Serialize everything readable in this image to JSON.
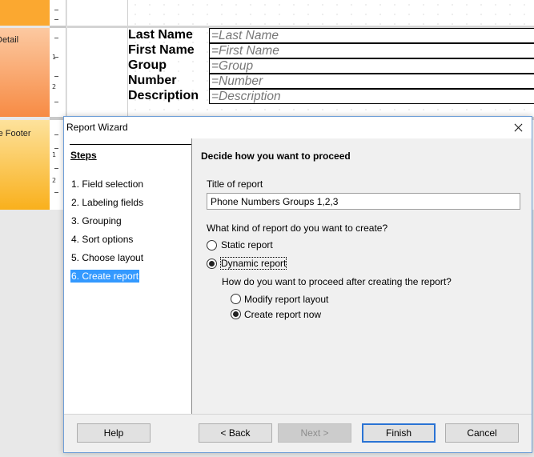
{
  "editor": {
    "sections": {
      "detail": "Detail",
      "page_footer": "Page Footer"
    },
    "ruler_numbers": [
      "1",
      "2",
      "1",
      "2"
    ],
    "fields": [
      {
        "label": "Last Name",
        "expr": "=Last Name"
      },
      {
        "label": "First Name",
        "expr": "=First Name"
      },
      {
        "label": "Group",
        "expr": "=Group"
      },
      {
        "label": "Number",
        "expr": "=Number"
      },
      {
        "label": "Description",
        "expr": "=Description"
      }
    ]
  },
  "dialog": {
    "title": "Report Wizard",
    "steps_title": "Steps",
    "steps": [
      "1. Field selection",
      "2. Labeling fields",
      "3. Grouping",
      "4. Sort options",
      "5. Choose layout",
      "6. Create report"
    ],
    "active_step_index": 5,
    "heading": "Decide how you want to proceed",
    "title_label": "Title of report",
    "title_value": "Phone Numbers Groups 1,2,3",
    "kind_question": "What kind of report do you want to create?",
    "kind_options": {
      "static": {
        "label": "Static report",
        "selected": false
      },
      "dynamic": {
        "label": "Dynamic report",
        "selected": true
      }
    },
    "proceed_question": "How do you want to proceed after creating the report?",
    "proceed_options": {
      "modify": {
        "label": "Modify report layout",
        "selected": false
      },
      "create": {
        "label": "Create report now",
        "selected": true
      }
    },
    "buttons": {
      "help": "Help",
      "back": "< Back",
      "next": "Next >",
      "finish": "Finish",
      "cancel": "Cancel"
    },
    "colors": {
      "active_step": "#3399ff",
      "default_button_border": "#2a73d4"
    }
  }
}
